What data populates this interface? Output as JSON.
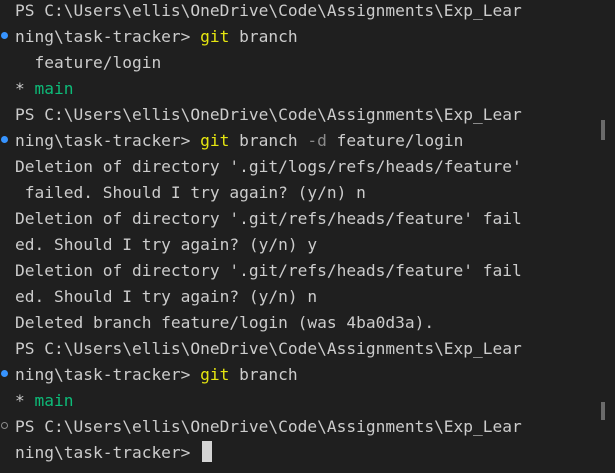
{
  "terminal": {
    "colors": {
      "background": "#1f1f1f",
      "text": "#cccccc",
      "command": "#e5e510",
      "flag": "#8a8a8a",
      "current_branch": "#0dbc79",
      "decoration_success": "#3794ff"
    },
    "blocks": [
      {
        "prompt_line1": "PS C:\\Users\\ellis\\OneDrive\\Code\\Assignments\\Exp_Lear",
        "prompt_line2": "ning\\task-tracker> ",
        "cmd": "git",
        "args1": " branch",
        "output": [
          {
            "text": "  feature/login"
          },
          {
            "prefix": "* ",
            "branch": "main"
          }
        ]
      },
      {
        "prompt_line1": "PS C:\\Users\\ellis\\OneDrive\\Code\\Assignments\\Exp_Lear",
        "prompt_line2": "ning\\task-tracker> ",
        "cmd": "git",
        "args1": " branch ",
        "flag": "-d",
        "args2": " feature/login",
        "output": [
          "Deletion of directory '.git/logs/refs/heads/feature'",
          " failed. Should I try again? (y/n) n",
          "Deletion of directory '.git/refs/heads/feature' fail",
          "ed. Should I try again? (y/n) y",
          "Deletion of directory '.git/refs/heads/feature' fail",
          "ed. Should I try again? (y/n) n",
          "Deleted branch feature/login (was 4ba0d3a)."
        ]
      },
      {
        "prompt_line1": "PS C:\\Users\\ellis\\OneDrive\\Code\\Assignments\\Exp_Lear",
        "prompt_line2": "ning\\task-tracker> ",
        "cmd": "git",
        "args1": " branch",
        "output": [
          {
            "prefix": "* ",
            "branch": "main"
          }
        ]
      },
      {
        "prompt_line1": "PS C:\\Users\\ellis\\OneDrive\\Code\\Assignments\\Exp_Lear",
        "prompt_line2": "ning\\task-tracker> "
      }
    ]
  }
}
